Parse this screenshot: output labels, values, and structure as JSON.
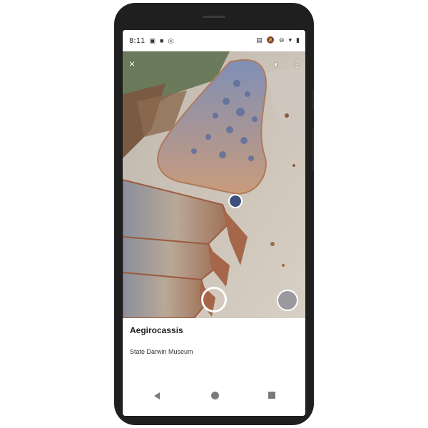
{
  "status_bar": {
    "time": "8:11",
    "left_icons": [
      "image-icon",
      "video-icon",
      "sync-icon"
    ],
    "right_icons": [
      "cast-icon",
      "mute-icon",
      "dnd-icon",
      "wifi-icon",
      "battery-icon"
    ]
  },
  "camera_view": {
    "top_left_icon": "close-icon",
    "top_right_icons": [
      "contrast-icon",
      "more-vert-icon"
    ],
    "controls": [
      "shutter-button",
      "gallery-thumbnail"
    ]
  },
  "result": {
    "title": "Aegirocassis",
    "subtitle": "State Darwin Museum"
  },
  "nav_bar": {
    "buttons": [
      "back-button",
      "home-button",
      "recents-button"
    ]
  },
  "colors": {
    "phone_frame": "#1f1f1f",
    "screen_bg": "#ffffff",
    "shutter_ring": "#ffffff",
    "nav_icons": "#7a7a7a"
  }
}
